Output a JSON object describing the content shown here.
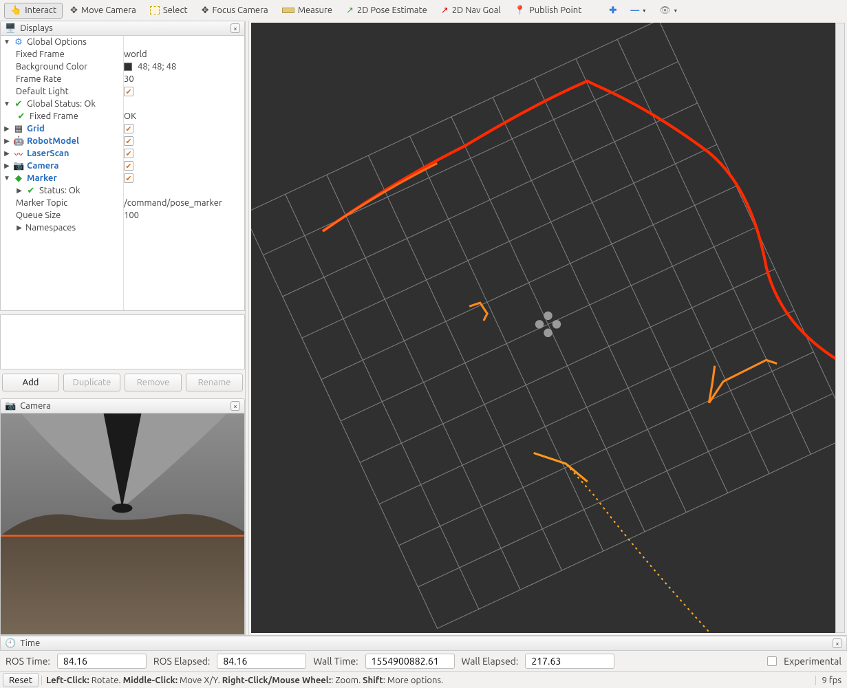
{
  "toolbar": {
    "interact": "Interact",
    "move_camera": "Move Camera",
    "select": "Select",
    "focus_camera": "Focus Camera",
    "measure": "Measure",
    "pose_estimate": "2D Pose Estimate",
    "nav_goal": "2D Nav Goal",
    "publish_point": "Publish Point"
  },
  "displays": {
    "title": "Displays",
    "global_options": {
      "label": "Global Options",
      "fixed_frame": {
        "label": "Fixed Frame",
        "value": "world"
      },
      "background_color": {
        "label": "Background Color",
        "value": "48; 48; 48",
        "hex": "#303030"
      },
      "frame_rate": {
        "label": "Frame Rate",
        "value": "30"
      },
      "default_light": {
        "label": "Default Light",
        "checked": true
      }
    },
    "global_status": {
      "label": "Global Status: Ok",
      "fixed_frame": {
        "label": "Fixed Frame",
        "value": "OK"
      }
    },
    "items": [
      {
        "label": "Grid",
        "checked": true
      },
      {
        "label": "RobotModel",
        "checked": true
      },
      {
        "label": "LaserScan",
        "checked": true
      },
      {
        "label": "Camera",
        "checked": true
      }
    ],
    "marker": {
      "label": "Marker",
      "checked": true,
      "status": {
        "label": "Status: Ok"
      },
      "topic": {
        "label": "Marker Topic",
        "value": "/command/pose_marker"
      },
      "queue": {
        "label": "Queue Size",
        "value": "100"
      },
      "ns": {
        "label": "Namespaces"
      }
    },
    "buttons": {
      "add": "Add",
      "duplicate": "Duplicate",
      "remove": "Remove",
      "rename": "Rename"
    }
  },
  "camera_panel": {
    "title": "Camera"
  },
  "time": {
    "title": "Time",
    "ros_time": {
      "label": "ROS Time:",
      "value": "84.16"
    },
    "ros_elapsed": {
      "label": "ROS Elapsed:",
      "value": "84.16"
    },
    "wall_time": {
      "label": "Wall Time:",
      "value": "1554900882.61"
    },
    "wall_elapsed": {
      "label": "Wall Elapsed:",
      "value": "217.63"
    },
    "experimental": "Experimental"
  },
  "bottom": {
    "reset": "Reset",
    "hint_parts": {
      "lc": "Left-Click:",
      "lc_t": " Rotate. ",
      "mc": "Middle-Click:",
      "mc_t": " Move X/Y. ",
      "rc": "Right-Click/Mouse Wheel:",
      "rc_t": ": Zoom. ",
      "sh": "Shift",
      "sh_t": ": More options."
    },
    "fps": "9 fps"
  }
}
